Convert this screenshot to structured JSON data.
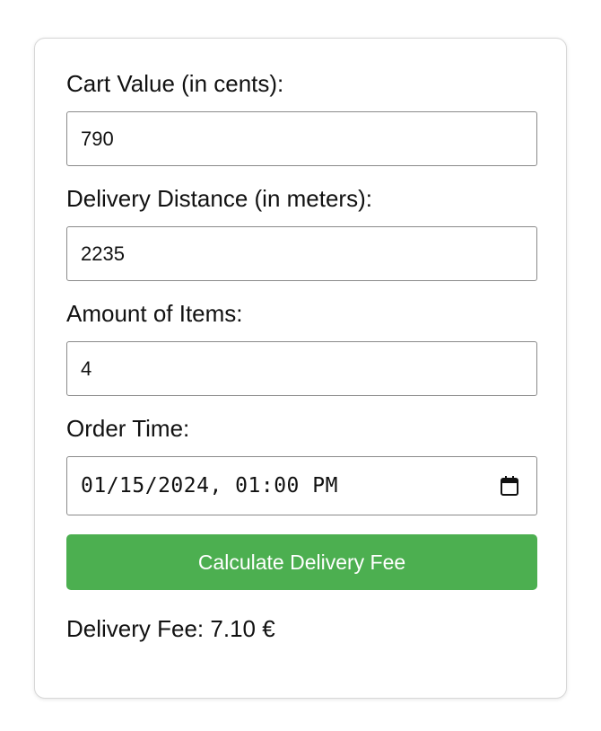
{
  "form": {
    "cart_value": {
      "label": "Cart Value (in cents):",
      "value": "790"
    },
    "delivery_distance": {
      "label": "Delivery Distance (in meters):",
      "value": "2235"
    },
    "amount_of_items": {
      "label": "Amount of Items:",
      "value": "4"
    },
    "order_time": {
      "label": "Order Time:",
      "value": "01/15/2024, 01:00 PM",
      "icon": "calendar-icon"
    },
    "submit_label": "Calculate Delivery Fee",
    "result_text": "Delivery Fee: 7.10 €"
  },
  "colors": {
    "button": "#4caf50",
    "button_text": "#ffffff",
    "border": "#8a8a8a"
  }
}
